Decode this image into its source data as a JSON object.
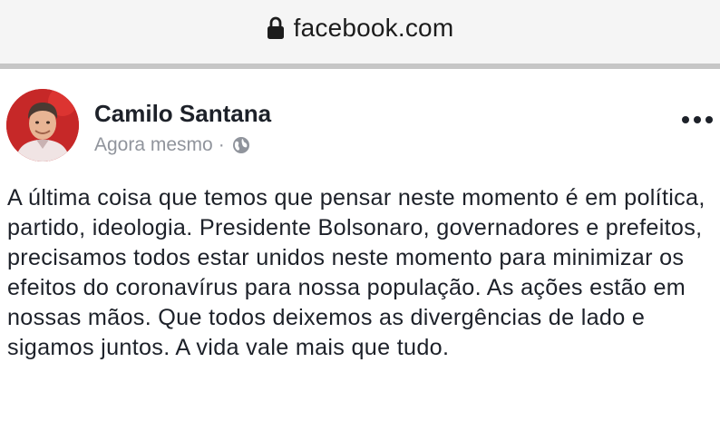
{
  "browser": {
    "url": "facebook.com",
    "lock_icon": "lock-icon"
  },
  "post": {
    "author": "Camilo Santana",
    "timestamp": "Agora mesmo",
    "separator": "·",
    "privacy_icon": "globe-icon",
    "more_icon": "more-horizontal-icon",
    "text": "A última coisa que temos que pensar neste momento é em política, partido, ideologia. Presidente Bolsonaro, governadores e prefeitos, precisamos todos estar unidos neste momento para minimizar os efeitos do coronavírus para nossa população. As ações estão em nossas mãos. Que todos deixemos as divergências de lado e sigamos juntos. A vida vale mais que tudo."
  },
  "colors": {
    "bar_background": "#f5f5f5",
    "divider": "#c6c6c6",
    "name": "#1d2129",
    "meta": "#90949c",
    "avatar_background": "#c62828"
  }
}
